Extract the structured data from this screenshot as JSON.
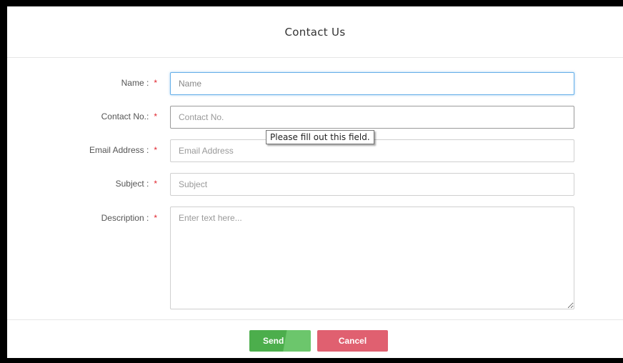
{
  "modal": {
    "title": "Contact Us"
  },
  "form": {
    "required_mark": "*",
    "fields": [
      {
        "label": "Name :",
        "placeholder": "Name"
      },
      {
        "label": "Contact No.:",
        "placeholder": "Contact No."
      },
      {
        "label": "Email Address :",
        "placeholder": "Email Address"
      },
      {
        "label": "Subject :",
        "placeholder": "Subject"
      },
      {
        "label": "Description :",
        "placeholder": "Enter text here..."
      }
    ],
    "validation_tooltip": "Please fill out this field."
  },
  "footer": {
    "send_label": "Send",
    "cancel_label": "Cancel"
  },
  "colors": {
    "send": "#4cae4c",
    "cancel": "#e06070",
    "required": "#e0262f",
    "focus": "#66afe9"
  }
}
